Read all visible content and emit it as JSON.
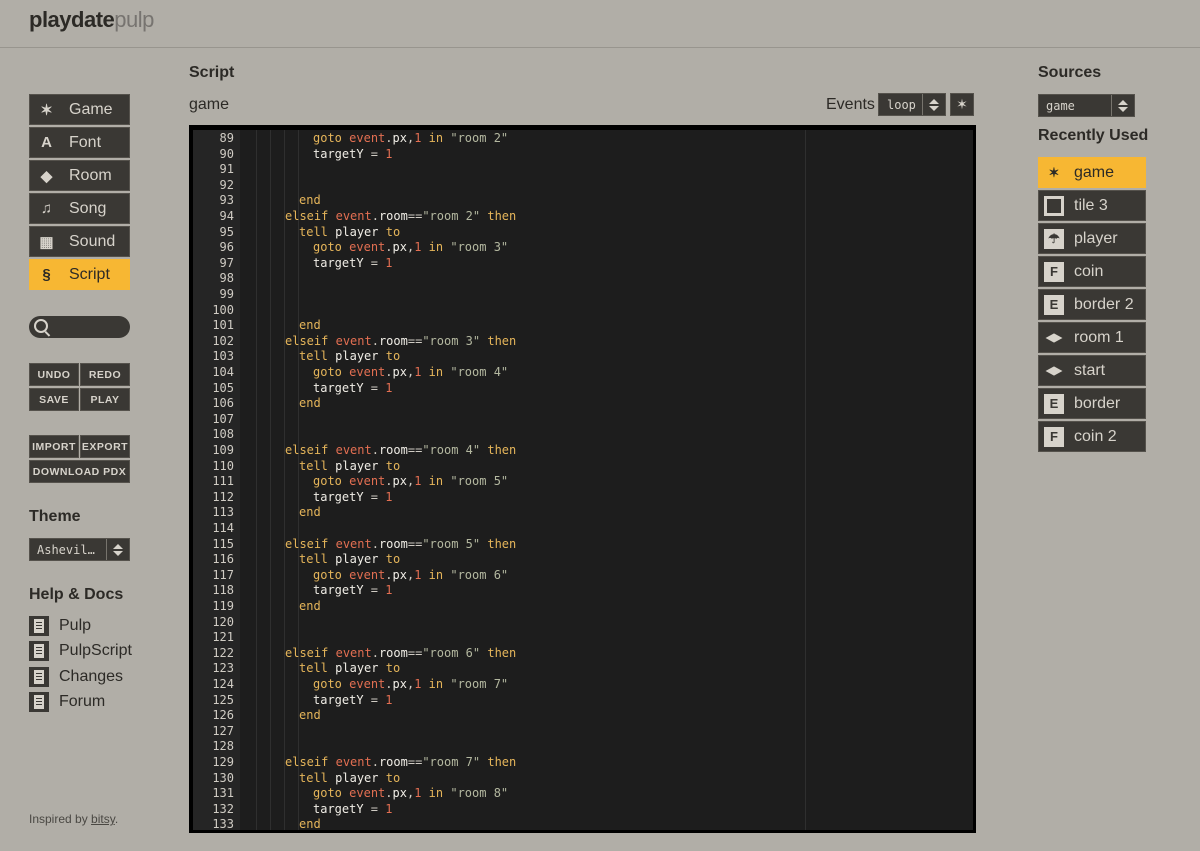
{
  "logo": {
    "part1": "playdate",
    "part2": "pulp"
  },
  "nav": [
    {
      "label": "Game",
      "icon": "sparkle-icon",
      "glyph": "✶",
      "active": false
    },
    {
      "label": "Font",
      "icon": "font-icon",
      "glyph": "A",
      "active": false
    },
    {
      "label": "Room",
      "icon": "room-icon",
      "glyph": "◆",
      "active": false
    },
    {
      "label": "Song",
      "icon": "music-note-icon",
      "glyph": "♫",
      "active": false
    },
    {
      "label": "Sound",
      "icon": "sound-icon",
      "glyph": "▦",
      "active": false
    },
    {
      "label": "Script",
      "icon": "script-icon",
      "glyph": "§",
      "active": true
    }
  ],
  "buttons": {
    "undo": "UNDO",
    "redo": "REDO",
    "save": "SAVE",
    "play": "PLAY",
    "import": "IMPORT",
    "export": "EXPORT",
    "download": "DOWNLOAD PDX"
  },
  "theme": {
    "heading": "Theme",
    "value": "Ashevil…"
  },
  "help": {
    "heading": "Help & Docs",
    "items": [
      "Pulp",
      "PulpScript",
      "Changes",
      "Forum"
    ]
  },
  "footer": {
    "prefix": "Inspired by ",
    "link": "bitsy",
    "suffix": "."
  },
  "main": {
    "heading": "Script",
    "subtitle": "game",
    "events_label": "Events",
    "events_value": "loop"
  },
  "editor": {
    "lines": [
      {
        "n": "89",
        "i": 2,
        "t": "goto event.px,1 in \"room 2\""
      },
      {
        "n": "90",
        "i": 2,
        "t": "targetY = 1"
      },
      {
        "n": "91",
        "i": 0,
        "t": ""
      },
      {
        "n": "92",
        "i": 0,
        "t": ""
      },
      {
        "n": "93",
        "i": 1,
        "t": "end"
      },
      {
        "n": "94",
        "i": 0,
        "t": "elseif event.room==\"room 2\" then"
      },
      {
        "n": "95",
        "i": 1,
        "t": "tell player to"
      },
      {
        "n": "96",
        "i": 2,
        "t": "goto event.px,1 in \"room 3\""
      },
      {
        "n": "97",
        "i": 2,
        "t": "targetY = 1"
      },
      {
        "n": "98",
        "i": 0,
        "t": ""
      },
      {
        "n": "99",
        "i": 0,
        "t": ""
      },
      {
        "n": "100",
        "i": 0,
        "t": ""
      },
      {
        "n": "101",
        "i": 1,
        "t": "end"
      },
      {
        "n": "102",
        "i": 0,
        "t": "elseif event.room==\"room 3\" then"
      },
      {
        "n": "103",
        "i": 1,
        "t": "tell player to"
      },
      {
        "n": "104",
        "i": 2,
        "t": "goto event.px,1 in \"room 4\""
      },
      {
        "n": "105",
        "i": 2,
        "t": "targetY = 1"
      },
      {
        "n": "106",
        "i": 1,
        "t": "end"
      },
      {
        "n": "107",
        "i": 0,
        "t": ""
      },
      {
        "n": "108",
        "i": 0,
        "t": ""
      },
      {
        "n": "109",
        "i": 0,
        "t": "elseif event.room==\"room 4\" then"
      },
      {
        "n": "110",
        "i": 1,
        "t": "tell player to"
      },
      {
        "n": "111",
        "i": 2,
        "t": "goto event.px,1 in \"room 5\""
      },
      {
        "n": "112",
        "i": 2,
        "t": "targetY = 1"
      },
      {
        "n": "113",
        "i": 1,
        "t": "end"
      },
      {
        "n": "114",
        "i": 0,
        "t": ""
      },
      {
        "n": "115",
        "i": 0,
        "t": "elseif event.room==\"room 5\" then"
      },
      {
        "n": "116",
        "i": 1,
        "t": "tell player to"
      },
      {
        "n": "117",
        "i": 2,
        "t": "goto event.px,1 in \"room 6\""
      },
      {
        "n": "118",
        "i": 2,
        "t": "targetY = 1"
      },
      {
        "n": "119",
        "i": 1,
        "t": "end"
      },
      {
        "n": "120",
        "i": 0,
        "t": ""
      },
      {
        "n": "121",
        "i": 0,
        "t": ""
      },
      {
        "n": "122",
        "i": 0,
        "t": "elseif event.room==\"room 6\" then"
      },
      {
        "n": "123",
        "i": 1,
        "t": "tell player to"
      },
      {
        "n": "124",
        "i": 2,
        "t": "goto event.px,1 in \"room 7\""
      },
      {
        "n": "125",
        "i": 2,
        "t": "targetY = 1"
      },
      {
        "n": "126",
        "i": 1,
        "t": "end"
      },
      {
        "n": "127",
        "i": 0,
        "t": ""
      },
      {
        "n": "128",
        "i": 0,
        "t": ""
      },
      {
        "n": "129",
        "i": 0,
        "t": "elseif event.room==\"room 7\" then"
      },
      {
        "n": "130",
        "i": 1,
        "t": "tell player to"
      },
      {
        "n": "131",
        "i": 2,
        "t": "goto event.px,1 in \"room 8\""
      },
      {
        "n": "132",
        "i": 2,
        "t": "targetY = 1"
      },
      {
        "n": "133",
        "i": 1,
        "t": "end"
      }
    ]
  },
  "sources": {
    "heading": "Sources",
    "value": "game",
    "recent_heading": "Recently Used"
  },
  "recent": [
    {
      "label": "game",
      "icon": "sparkle-icon",
      "glyph": "✶",
      "active": true,
      "kind": "game"
    },
    {
      "label": "tile 3",
      "icon": "tile-icon",
      "glyph": "",
      "active": false,
      "kind": "tile"
    },
    {
      "label": "player",
      "icon": "player-icon",
      "glyph": "☂",
      "active": false,
      "kind": "glyph"
    },
    {
      "label": "coin",
      "icon": "coin-icon",
      "glyph": "F",
      "active": false,
      "kind": "glyph"
    },
    {
      "label": "border 2",
      "icon": "border-icon",
      "glyph": "E",
      "active": false,
      "kind": "glyph"
    },
    {
      "label": "room 1",
      "icon": "room-icon",
      "glyph": "",
      "active": false,
      "kind": "room"
    },
    {
      "label": "start",
      "icon": "room-icon",
      "glyph": "",
      "active": false,
      "kind": "room"
    },
    {
      "label": "border",
      "icon": "border-icon",
      "glyph": "E",
      "active": false,
      "kind": "glyph"
    },
    {
      "label": "coin 2",
      "icon": "coin-icon",
      "glyph": "F",
      "active": false,
      "kind": "glyph"
    }
  ],
  "colors": {
    "accent": "#f7b733",
    "panel": "#3a3834",
    "background": "#b1aea7",
    "editor": "#1d1d1d",
    "keyword": "#e5b55a",
    "event": "#e36f52",
    "string": "#b4b8a0"
  }
}
